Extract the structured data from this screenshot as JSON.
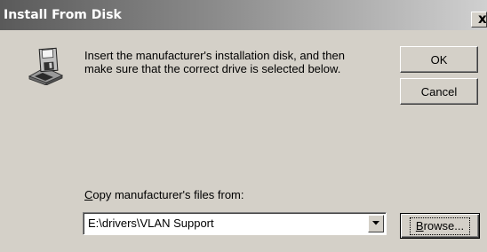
{
  "window": {
    "title": "Install From Disk",
    "close_glyph": "x"
  },
  "icons": {
    "dialog_icon": "floppy-disk-drive-icon",
    "dropdown_arrow": "triangle-down-icon"
  },
  "message": {
    "line1": "Insert the manufacturer's installation disk, and then",
    "line2": "make sure that the correct drive is selected below."
  },
  "buttons": {
    "ok": "OK",
    "cancel": "Cancel",
    "browse_mnemonic": "B",
    "browse_rest": "rowse..."
  },
  "copy_from": {
    "label_mnemonic": "C",
    "label_rest": "opy manufacturer's files from:",
    "value": "E:\\drivers\\VLAN Support"
  },
  "colors": {
    "dialog_bg": "#d4d0c8",
    "title_gradient_start": "#5a5a5a",
    "title_gradient_end": "#d0d0d0"
  }
}
